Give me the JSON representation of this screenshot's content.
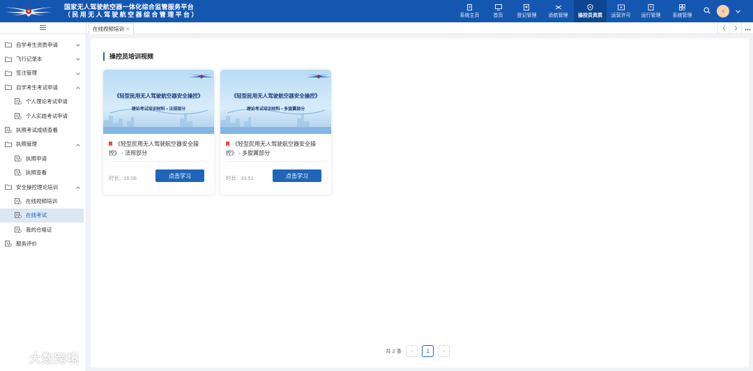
{
  "header": {
    "title_line1": "国家无人驾驶航空器一体化综合监管服务平台",
    "title_line2": "（民用无人驾驶航空器综合管理平台）",
    "nav": [
      {
        "label": "系统主页",
        "icon": "home-doc-icon"
      },
      {
        "label": "首页",
        "icon": "monitor-icon"
      },
      {
        "label": "登记管理",
        "icon": "register-icon"
      },
      {
        "label": "适航管理",
        "icon": "drone-icon"
      },
      {
        "label": "操控员资质",
        "icon": "shield-icon",
        "active": true
      },
      {
        "label": "运营许可",
        "icon": "license-icon"
      },
      {
        "label": "运行管理",
        "icon": "operation-icon"
      },
      {
        "label": "系统管理",
        "icon": "settings-icon"
      }
    ],
    "avatar_text": "s",
    "colors": {
      "bar": "#1557b0",
      "active": "#0d468f"
    }
  },
  "sidebar": {
    "items": [
      {
        "label": "自学考生资质申请",
        "icon": "folder-icon",
        "arrow": "down"
      },
      {
        "label": "飞行记录本",
        "icon": "folder-icon",
        "arrow": "down"
      },
      {
        "label": "签注管理",
        "icon": "folder-icon",
        "arrow": "down"
      },
      {
        "label": "自学考生考试申请",
        "icon": "folder-icon",
        "arrow": "up"
      },
      {
        "label": "个人理论考试申请",
        "icon": "doc-icon",
        "sub": true
      },
      {
        "label": "个人实践考试申请",
        "icon": "doc-icon",
        "sub": true
      },
      {
        "label": "执照考试成绩查看",
        "icon": "doc-icon"
      },
      {
        "label": "执照管理",
        "icon": "folder-icon",
        "arrow": "up"
      },
      {
        "label": "执照申请",
        "icon": "doc-icon",
        "sub": true
      },
      {
        "label": "执照查看",
        "icon": "doc-icon",
        "sub": true
      },
      {
        "label": "安全操控理论培训",
        "icon": "folder-icon",
        "arrow": "up"
      },
      {
        "label": "在线视频培训",
        "icon": "doc-icon",
        "sub": true
      },
      {
        "label": "在线考试",
        "icon": "doc-icon",
        "sub": true,
        "active": true
      },
      {
        "label": "我的合格证",
        "icon": "doc-icon",
        "sub": true
      },
      {
        "label": "服务评价",
        "icon": "doc-icon"
      }
    ]
  },
  "tabs": {
    "active_label": "在线视频培训",
    "close": "×"
  },
  "main": {
    "section_title": "操控员培训视频",
    "cards": [
      {
        "cover_title": "《轻型民用无人驾驶航空器安全操控》",
        "cover_subtitle": "理论考试培训材料 • 法规部分",
        "title": "《轻型民用无人驾驶航空器安全操控》 - 法规部分",
        "duration_label": "时长:",
        "duration": "16:08",
        "button": "点击学习"
      },
      {
        "cover_title": "《轻型民用无人驾驶航空器安全操控》",
        "cover_subtitle": "理论考试培训材料 • 多旋翼部分",
        "title": "《轻型民用无人驾驶航空器安全操控》 - 多旋翼部分",
        "duration_label": "时长:",
        "duration": "33:51",
        "button": "点击学习"
      }
    ]
  },
  "pagination": {
    "total": "共 2 条",
    "current_page": "1",
    "prev": "‹",
    "next": "›"
  },
  "watermark": "大数跨境"
}
